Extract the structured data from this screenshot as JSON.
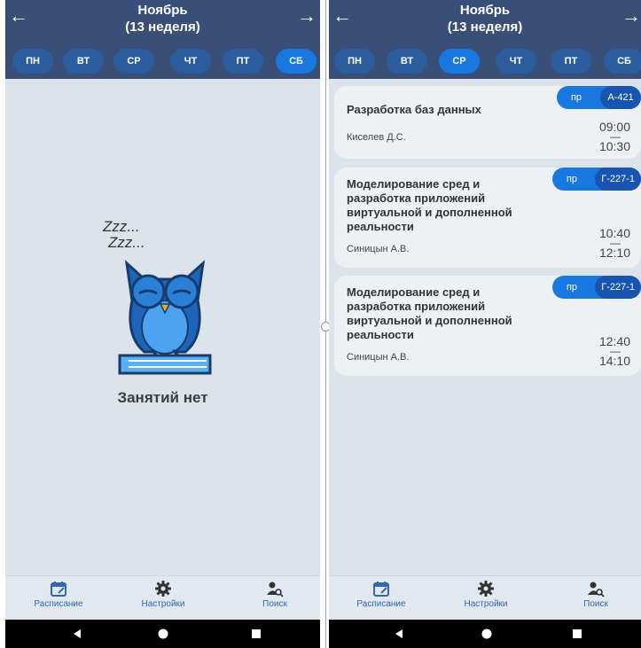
{
  "left": {
    "header": {
      "month": "Ноябрь",
      "week": "(13 неделя)"
    },
    "days": [
      "ПН",
      "ВТ",
      "СР",
      "ЧТ",
      "ПТ",
      "СБ"
    ],
    "active_day": 5,
    "empty": {
      "zzz1": "Zzz...",
      "zzz2": "Zzz...",
      "message": "Занятий нет"
    },
    "nav": {
      "schedule": "Расписание",
      "settings": "Настройки",
      "search": "Поиск"
    }
  },
  "right": {
    "header": {
      "month": "Ноябрь",
      "week": "(13 неделя)"
    },
    "days": [
      "ПН",
      "ВТ",
      "СР",
      "ЧТ",
      "ПТ",
      "СБ"
    ],
    "active_day": 2,
    "lessons": [
      {
        "title": "Разработка баз данных",
        "teacher": "Киселев Д.С.",
        "type": "пр",
        "room": "А-421",
        "start": "09:00",
        "sep": "—",
        "end": "10:30"
      },
      {
        "title": "Моделирование сред и разработка приложений виртуальной и дополненной реальности",
        "teacher": "Синицын А.В.",
        "type": "пр",
        "room": "Г-227-1",
        "start": "10:40",
        "sep": "—",
        "end": "12:10"
      },
      {
        "title": "Моделирование сред и разработка приложений виртуальной и дополненной реальности",
        "teacher": "Синицын А.В.",
        "type": "пр",
        "room": "Г-227-1",
        "start": "12:40",
        "sep": "—",
        "end": "14:10"
      }
    ],
    "nav": {
      "schedule": "Расписание",
      "settings": "Настройки",
      "search": "Поиск"
    }
  },
  "icons": {
    "prev": "arrow-left-icon",
    "next": "arrow-right-icon",
    "schedule": "calendar-edit-icon",
    "settings": "gear-icon",
    "search": "person-search-icon"
  },
  "colors": {
    "header": "#3a4f77",
    "day_pill": "#2c5d9e",
    "day_active": "#1977e0",
    "accent": "#3266b0"
  }
}
